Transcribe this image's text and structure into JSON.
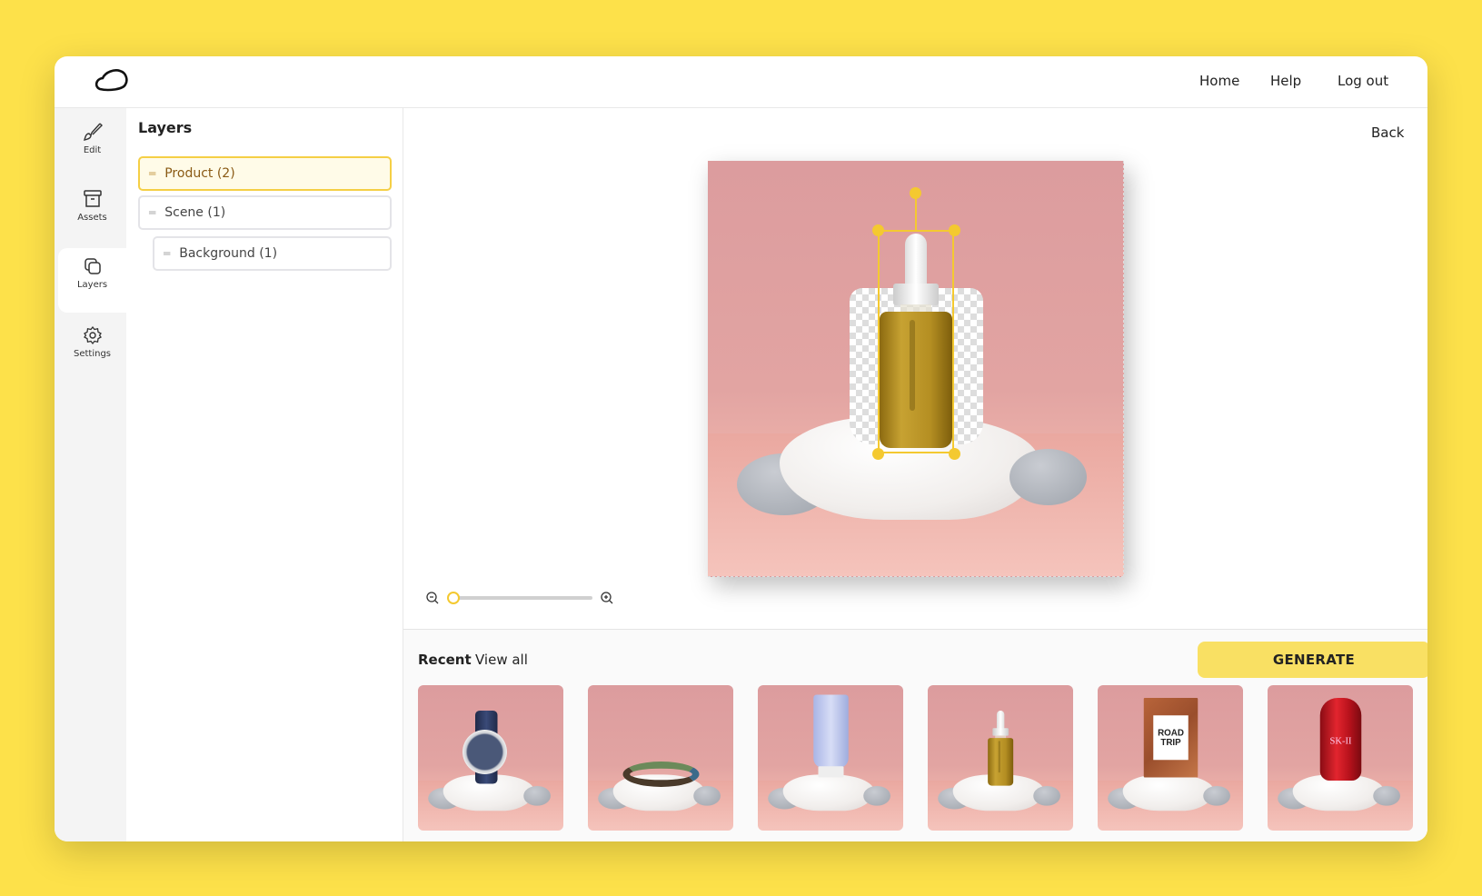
{
  "header": {
    "logo": "cloud-logo",
    "nav": [
      "Home",
      "Help",
      "Log out"
    ]
  },
  "sidebar": {
    "items": [
      {
        "label": "Edit",
        "icon": "brush-icon"
      },
      {
        "label": "Assets",
        "icon": "archive-icon"
      },
      {
        "label": "Layers",
        "icon": "layers-icon",
        "active": true
      },
      {
        "label": "Settings",
        "icon": "gear-icon"
      }
    ]
  },
  "layers": {
    "title": "Layers",
    "rows": [
      {
        "label": "Product (2)",
        "selected": true
      },
      {
        "label": "Scene (1)"
      },
      {
        "label": "Background (1)"
      }
    ]
  },
  "canvas": {
    "back_label": "Back",
    "zoom_level": 0
  },
  "bottom": {
    "recent_label": "Recent",
    "view_all_label": "View all",
    "generate_label": "GENERATE",
    "thumbnails": [
      {
        "product": "watch"
      },
      {
        "product": "bracelet"
      },
      {
        "product": "tube"
      },
      {
        "product": "oil-bottle"
      },
      {
        "product": "box",
        "text": "ROAD TRIP"
      },
      {
        "product": "red-bottle",
        "text": "SK-II"
      }
    ]
  },
  "colors": {
    "background": "#fde14a",
    "accent": "#f4c930",
    "generate": "#f9e063"
  }
}
